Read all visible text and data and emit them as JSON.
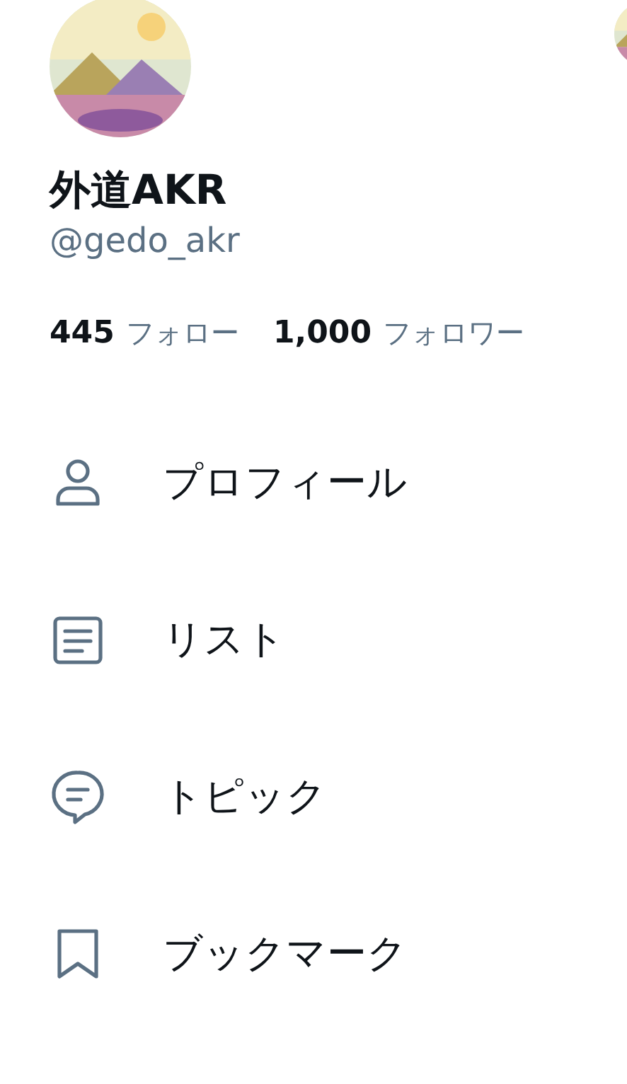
{
  "profile": {
    "name": "外道AKR",
    "handle": "@gedo_akr"
  },
  "stats": [
    {
      "count": "445",
      "label": "フォロー"
    },
    {
      "count": "1,000",
      "label": "フォロワー"
    }
  ],
  "menu": [
    {
      "kind": "profile",
      "label": "プロフィール"
    },
    {
      "kind": "lists",
      "label": "リスト"
    },
    {
      "kind": "topics",
      "label": "トピック"
    },
    {
      "kind": "bookmarks",
      "label": "ブックマーク"
    }
  ]
}
